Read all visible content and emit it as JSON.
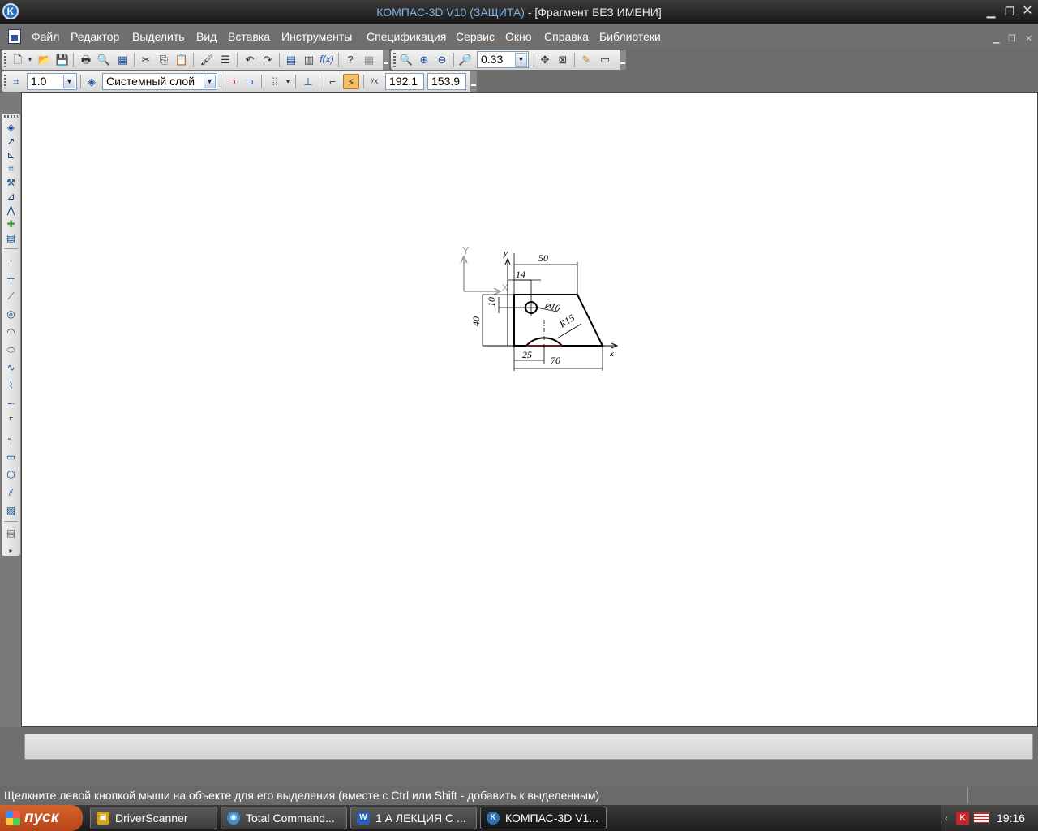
{
  "window": {
    "app_name": "КОМПАС-3D V10 (ЗАЩИТА)",
    "separator": " - ",
    "document": "[Фрагмент БЕЗ ИМЕНИ]"
  },
  "menu": [
    "Файл",
    "Редактор",
    "Выделить",
    "Вид",
    "Вставка",
    "Инструменты",
    "Спецификация",
    "Сервис",
    "Окно",
    "Справка",
    "Библиотеки"
  ],
  "toolbar": {
    "zoom_value": "0.33",
    "fx_label": "f(x)"
  },
  "params_bar": {
    "step_value": "1.0",
    "layer_name": "Системный слой",
    "coord_x": "192.1",
    "coord_y": "153.9"
  },
  "drawing": {
    "axis_y_label": "Y",
    "axis_x_label": "X",
    "local_y_label": "y",
    "local_x_label": "x",
    "dims": {
      "d50": "50",
      "d14": "14",
      "d10": "10",
      "d40": "40",
      "d25": "25",
      "d70": "70",
      "diam": "⌀10",
      "radius": "R15"
    }
  },
  "status": {
    "hint": "Щелкните левой кнопкой мыши на объекте для его выделения (вместе с Ctrl или Shift - добавить к выделенным)"
  },
  "taskbar": {
    "start_label": "пуск",
    "tasks": [
      {
        "label": "DriverScanner",
        "icon": "driverscanner-icon"
      },
      {
        "label": "Total Command...",
        "icon": "total-commander-icon"
      },
      {
        "label": "1  А ЛЕКЦИЯ С ...",
        "icon": "word-icon"
      },
      {
        "label": "КОМПАС-3D V1...",
        "icon": "kompas-icon"
      }
    ],
    "clock": "19:16"
  }
}
